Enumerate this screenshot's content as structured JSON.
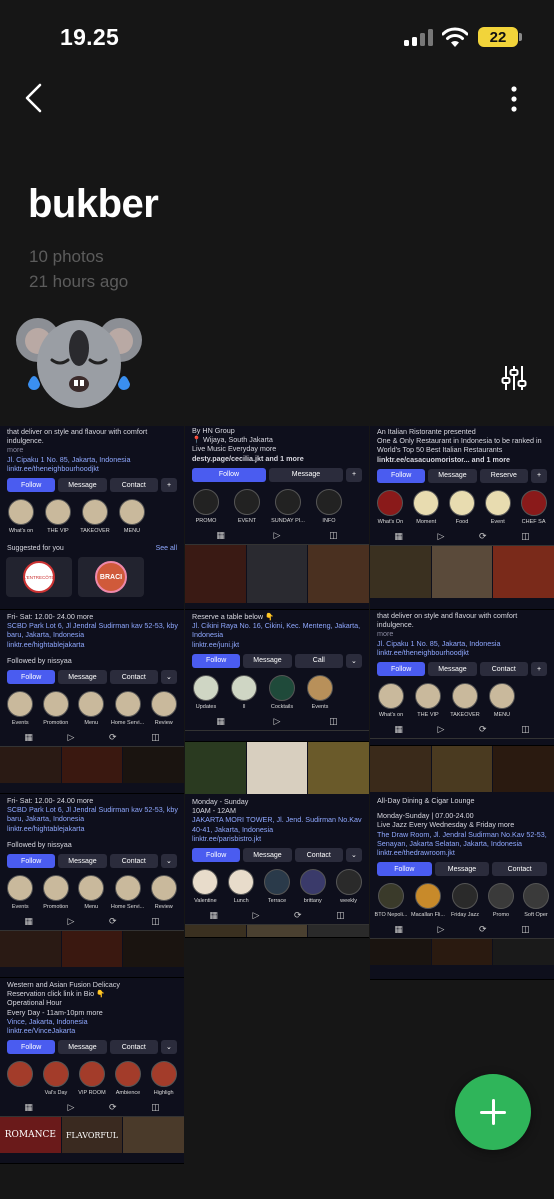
{
  "status": {
    "time": "19.25",
    "battery": "22"
  },
  "album": {
    "title": "bukber",
    "count": "10 photos",
    "updated": "21 hours ago"
  },
  "shots": {
    "c1a": {
      "lines": [
        "that deliver on style and flavour with comfort",
        "indulgence.",
        "more",
        "Jl. Cipaku 1 No. 85, Jakarta, Indonesia",
        "linktr.ee/theneighbourhoodjkt"
      ],
      "buttons": [
        "Follow",
        "Message",
        "Contact"
      ],
      "highlights": [
        "What's on",
        "THE VIP",
        "TAKEOVER",
        "MENU"
      ],
      "suggest": "Suggested for you",
      "see_all": "See all",
      "cards": [
        "L'ENTRECÔTE",
        "BRACI"
      ]
    },
    "c1b": {
      "lines": [
        "Fri- Sat: 12.00- 24.00  more",
        "SCBD Park Lot 6, Jl Jendral Sudirman kav 52-53, kby",
        "baru, Jakarta, Indonesia",
        "linktr.ee/hightablejakarta"
      ],
      "followed": "Followed by nissyaa",
      "buttons": [
        "Follow",
        "Message",
        "Contact"
      ],
      "highlights": [
        "Events",
        "Promotion",
        "Menu",
        "Home Servi...",
        "Review"
      ]
    },
    "c1c": {
      "lines": [
        "Fri- Sat: 12.00- 24.00  more",
        "SCBD Park Lot 6, Jl Jendral Sudirman kav 52-53, kby",
        "baru, Jakarta, Indonesia",
        "linktr.ee/hightablejakarta"
      ],
      "followed": "Followed by nissyaa",
      "buttons": [
        "Follow",
        "Message",
        "Contact"
      ],
      "highlights": [
        "Events",
        "Promotion",
        "Menu",
        "Home Servi...",
        "Review"
      ]
    },
    "c1d": {
      "lines": [
        "Western and Asian Fusion Delicacy",
        "Reservation click link in Bio 👇",
        "Operational Hour",
        "Every Day - 11am-10pm  more",
        "Vince, Jakarta, Indonesia",
        "linktr.ee/VinceJakarta"
      ],
      "buttons": [
        "Follow",
        "Message",
        "Contact"
      ],
      "highlights": [
        "",
        "Val's Day",
        "VIP ROOM",
        "Ambience",
        "Highligh"
      ],
      "thumbs": [
        "ROMANCE",
        "FLAVORFUL",
        ""
      ]
    },
    "c2a": {
      "lines": [
        "By HN Group",
        "📍 Wijaya, South Jakarta",
        "Live Music Everyday  more",
        "desty.page/cecilia.jkt and 1 more"
      ],
      "buttons": [
        "Follow",
        "Message"
      ],
      "highlights": [
        "PROMO",
        "EVENT",
        "SUNDAY PI...",
        "INFO"
      ]
    },
    "c2b": {
      "lines": [
        "Reserve a table below 👇",
        "Jl. Cikini Raya No. 16, Cikini, Kec. Menteng, Jakarta,",
        "Indonesia",
        "linktr.ee/juni.jkt"
      ],
      "buttons": [
        "Follow",
        "Message",
        "Call"
      ],
      "highlights": [
        "Updates",
        "II",
        "Cocktails",
        "Events"
      ]
    },
    "c2c": {
      "lines": [
        "Monday - Sunday",
        "10AM - 12AM",
        "JAKARTA MORI TOWER, Jl. Jend. Sudirman No.Kav",
        "40-41, Jakarta, Indonesia",
        "linktr.ee/parisbistro.jkt"
      ],
      "buttons": [
        "Follow",
        "Message",
        "Contact"
      ],
      "highlights": [
        "Valentine",
        "Lunch",
        "Terrace",
        "brittany",
        "weekly"
      ]
    },
    "c3a": {
      "lines": [
        "An Italian Ristorante presented",
        "One & Only Restaurant in Indonesia to be ranked in",
        "World's Top 50 Best Italian Restaurants",
        "linktr.ee/casacuomoristor... and 1 more"
      ],
      "buttons": [
        "Follow",
        "Message",
        "Reserve"
      ],
      "highlights": [
        "What's On",
        "Moment",
        "Food",
        "Event",
        "CHEF SA"
      ]
    },
    "c3b": {
      "lines": [
        "that deliver on style and flavour with comfort",
        "indulgence.",
        "more",
        "Jl. Cipaku 1 No. 85, Jakarta, Indonesia",
        "linktr.ee/theneighbourhoodjkt"
      ],
      "buttons": [
        "Follow",
        "Message",
        "Contact"
      ],
      "highlights": [
        "What's on",
        "THE VIP",
        "TAKEOVER",
        "MENU"
      ]
    },
    "c3c": {
      "lines": [
        "All-Day Dining & Cigar Lounge",
        "Monday-Sunday | 07.00-24.00",
        "Live Jazz Every Wednesday & Friday  more",
        "The Draw Room, Jl. Jendral Sudirman No.Kav 52-53,",
        "Senayan, Jakarta Selatan, Jakarta, Indonesia",
        "linktr.ee/thedrawroom.jkt"
      ],
      "buttons": [
        "Follow",
        "Message",
        "Contact"
      ],
      "highlights": [
        "BTO Nepoli...",
        "Macallan Fli...",
        "Friday Jazz",
        "Promo",
        "Soft Oper"
      ]
    }
  }
}
